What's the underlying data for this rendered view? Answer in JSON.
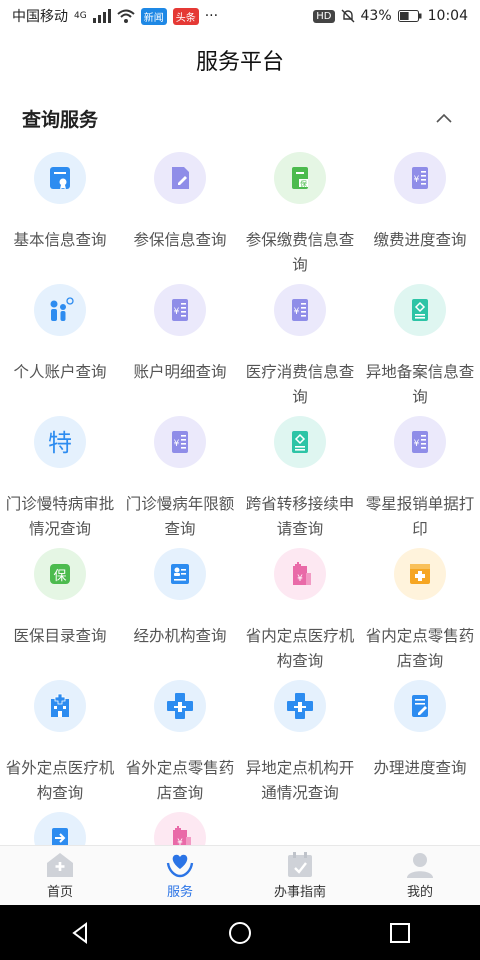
{
  "status_bar": {
    "carrier": "中国移动",
    "network": "4G",
    "badge_app1": "新闻",
    "badge_app2": "头条",
    "more": "···",
    "hd": "HD",
    "battery": "43%",
    "time": "10:04"
  },
  "app_bar": {
    "title": "服务平台"
  },
  "section": {
    "title": "查询服务",
    "toggle_icon": "chevron-up-icon"
  },
  "tiles": [
    {
      "label": "基本信息查询",
      "icon": "basic-info-icon"
    },
    {
      "label": "参保信息查询",
      "icon": "insurance-doc-icon"
    },
    {
      "label": "参保缴费信息查询",
      "icon": "insurance-pay-icon"
    },
    {
      "label": "缴费进度查询",
      "icon": "payment-list-icon"
    },
    {
      "label": "个人账户查询",
      "icon": "family-icon"
    },
    {
      "label": "账户明细查询",
      "icon": "account-detail-icon"
    },
    {
      "label": "医疗消费信息查询",
      "icon": "medical-list-icon"
    },
    {
      "label": "异地备案信息查询",
      "icon": "record-card-icon"
    },
    {
      "label": "门诊慢特病审批情况查询",
      "icon": "special-text-icon"
    },
    {
      "label": "门诊慢病年限额查询",
      "icon": "limit-list-icon"
    },
    {
      "label": "跨省转移接续申请查询",
      "icon": "transfer-card-icon"
    },
    {
      "label": "零星报销单据打印",
      "icon": "receipt-list-icon"
    },
    {
      "label": "医保目录查询",
      "icon": "catalog-icon"
    },
    {
      "label": "经办机构查询",
      "icon": "agency-card-icon"
    },
    {
      "label": "省内定点医疗机构查询",
      "icon": "hospital-pink-icon"
    },
    {
      "label": "省内定点零售药店查询",
      "icon": "pharmacy-orange-icon"
    },
    {
      "label": "省外定点医疗机构查询",
      "icon": "hospital-blue-icon"
    },
    {
      "label": "省外定点零售药店查询",
      "icon": "medical-cross-icon"
    },
    {
      "label": "异地定点机构开通情况查询",
      "icon": "medical-cross-icon"
    },
    {
      "label": "办理进度查询",
      "icon": "progress-doc-icon"
    },
    {
      "label": "",
      "icon": "login-icon"
    },
    {
      "label": "",
      "icon": "hospital-pink-icon"
    }
  ],
  "bottom_nav": [
    {
      "label": "首页",
      "icon": "home-icon"
    },
    {
      "label": "服务",
      "icon": "service-heart-icon",
      "active": true
    },
    {
      "label": "办事指南",
      "icon": "guide-calendar-icon"
    },
    {
      "label": "我的",
      "icon": "profile-icon"
    }
  ],
  "colors": {
    "accent": "#2b74e6",
    "blue_light": "#e5f1fd",
    "purple_light": "#ebe9fb",
    "green_light": "#e5f6e4",
    "teal_light": "#dff6f1",
    "pink_light": "#fde8f2",
    "orange_light": "#fff3dc"
  }
}
